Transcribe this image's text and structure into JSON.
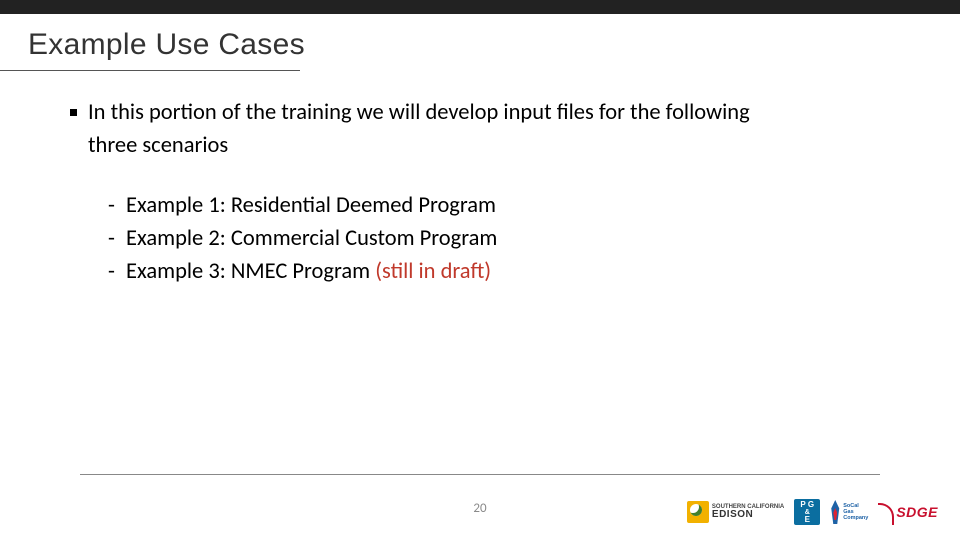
{
  "title": "Example Use Cases",
  "intro_line": "In this portion of the training we will develop input files for the following",
  "intro_cont": "three scenarios",
  "examples": [
    {
      "text": "Example 1: Residential Deemed Program"
    },
    {
      "text": "Example 2: Commercial Custom Program"
    },
    {
      "text": "Example 3: NMEC Program ",
      "note": "(still in draft)"
    }
  ],
  "page_number": "20",
  "logos": {
    "sce": {
      "top": "SOUTHERN CALIFORNIA",
      "main": "EDISON"
    },
    "pge": {
      "l1": "P G",
      "amp": "&",
      "l2": "E"
    },
    "scg": {
      "l1": "SoCal",
      "l2": "Gas",
      "l3": "Company"
    },
    "sdge": "SDGE"
  }
}
